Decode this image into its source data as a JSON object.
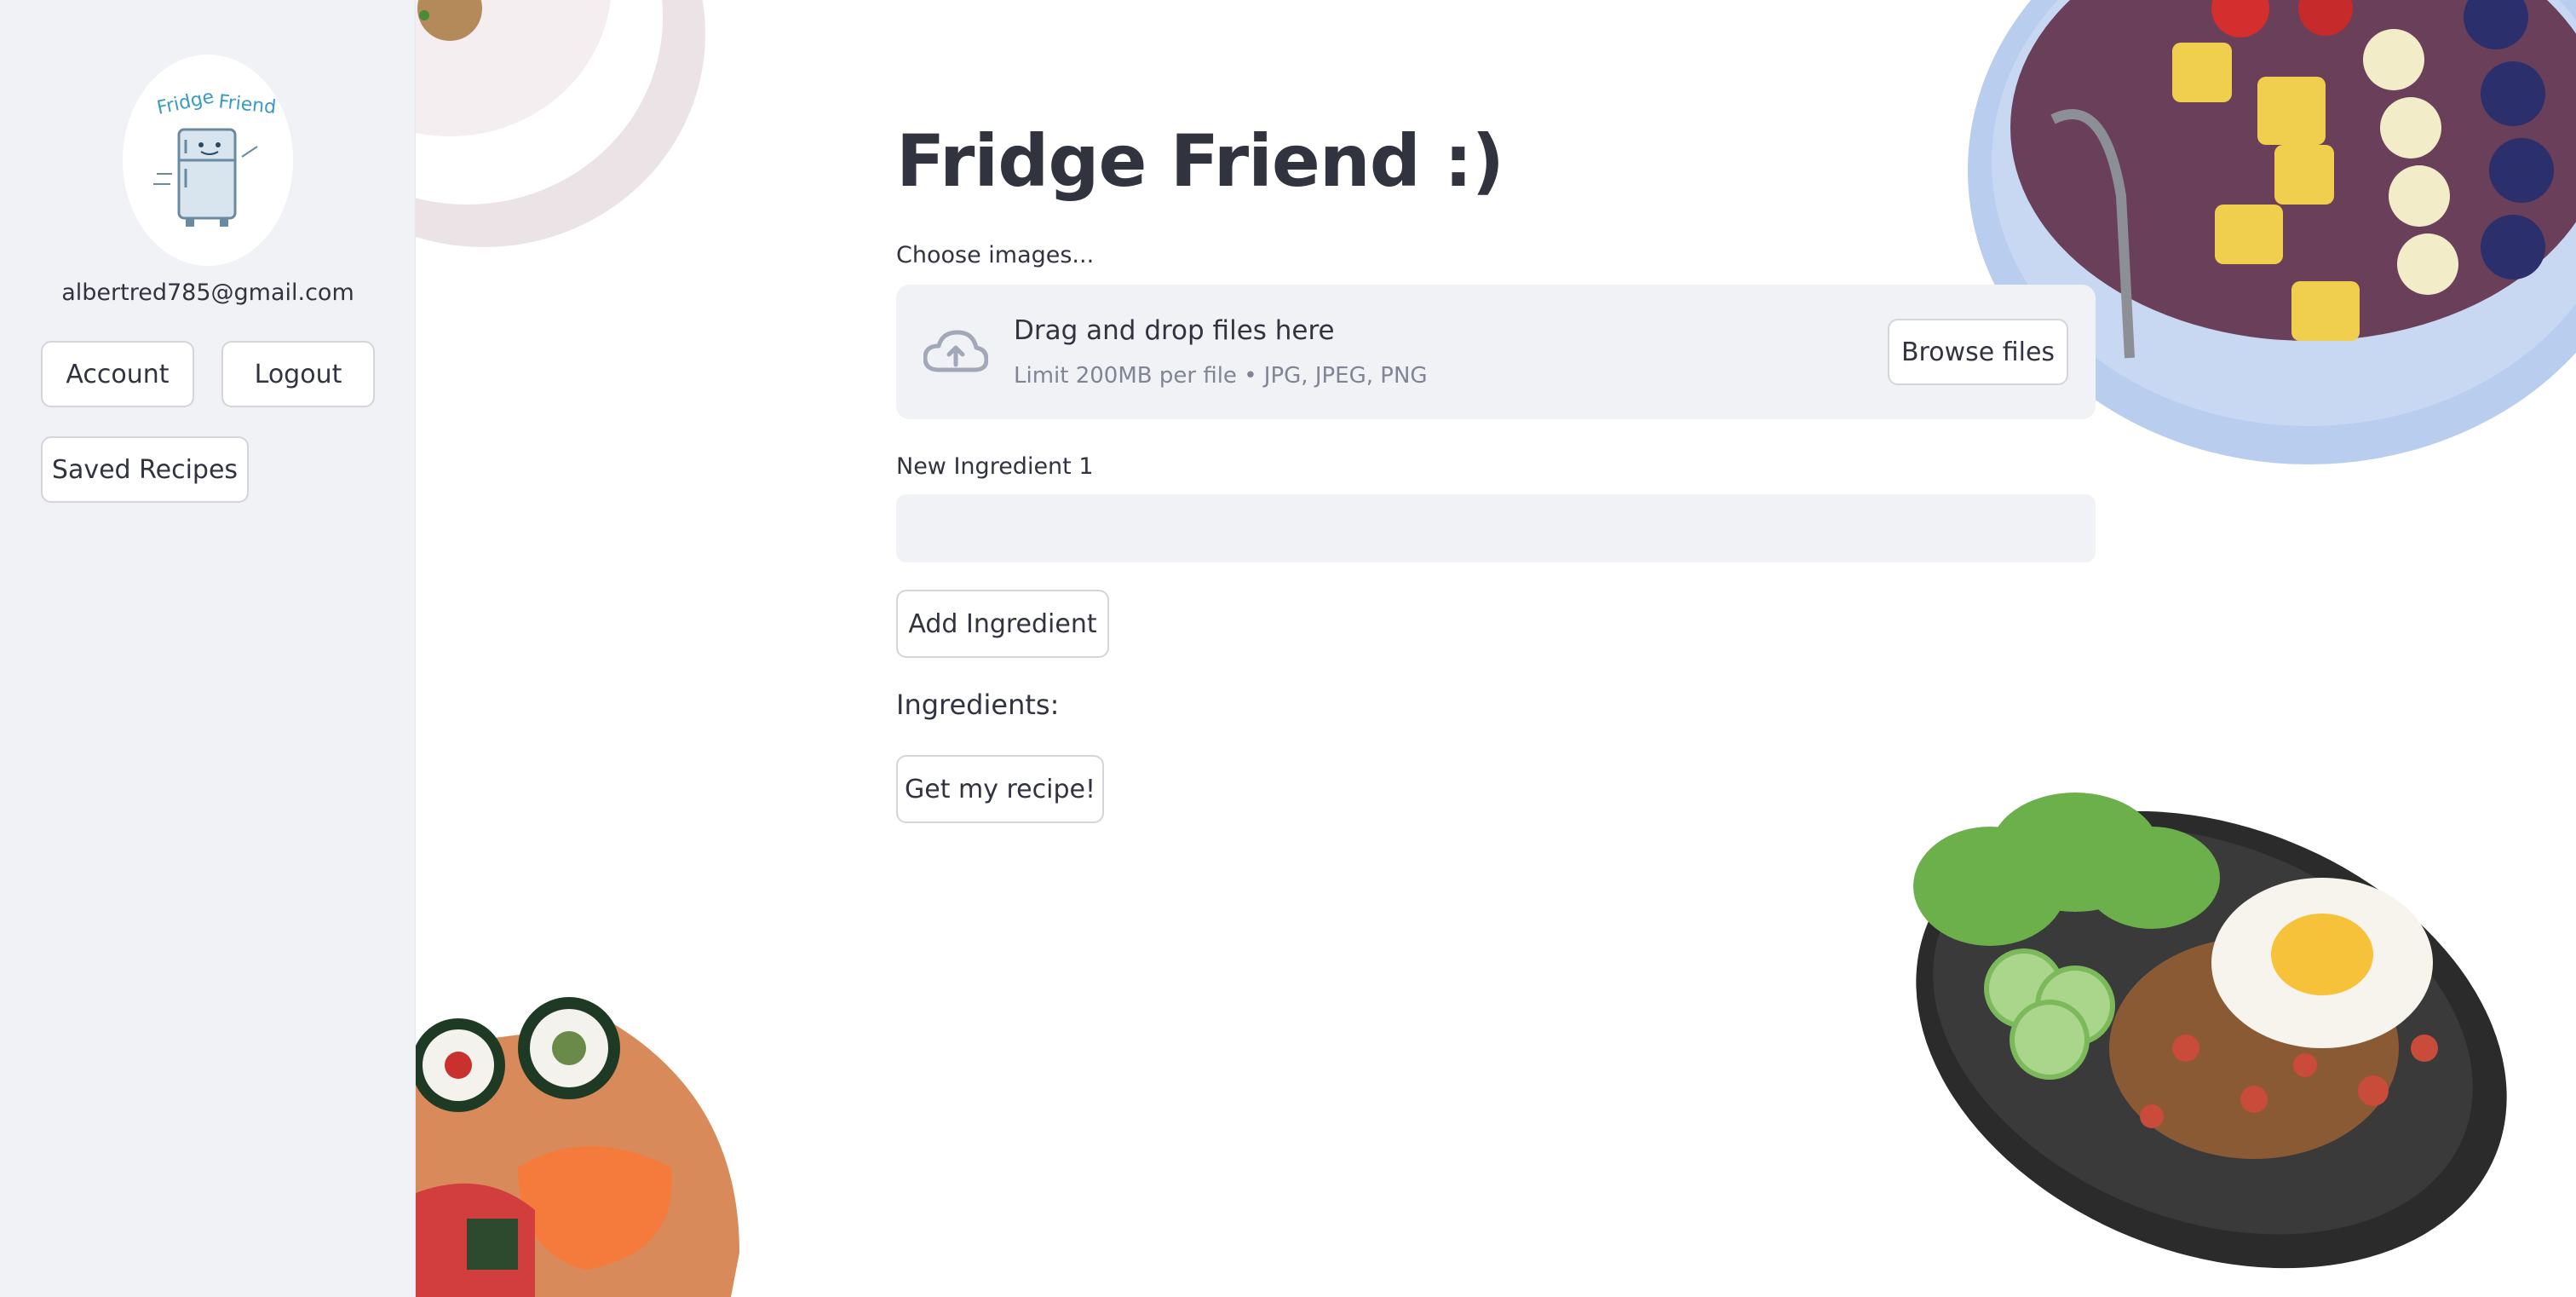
{
  "sidebar": {
    "avatar_text_left": "Fridge",
    "avatar_text_right": "Friend",
    "email": "albertred785@gmail.com",
    "account_label": "Account",
    "logout_label": "Logout",
    "saved_recipes_label": "Saved Recipes"
  },
  "main": {
    "title": "Fridge Friend :)",
    "choose_images_label": "Choose images...",
    "uploader": {
      "drop_text": "Drag and drop files here",
      "limit_text": "Limit 200MB per file • JPG, JPEG, PNG",
      "browse_label": "Browse files",
      "icon": "cloud-upload-icon"
    },
    "ingredient_input": {
      "label": "New Ingredient 1",
      "value": "",
      "placeholder": ""
    },
    "add_ingredient_label": "Add Ingredient",
    "ingredients_heading": "Ingredients:",
    "get_recipe_label": "Get my recipe!"
  },
  "colors": {
    "sidebar_bg": "#f0f2f6",
    "text": "#31333f",
    "muted_text": "#808495",
    "border": "#d3d5db",
    "icon": "#a3a8b8"
  }
}
